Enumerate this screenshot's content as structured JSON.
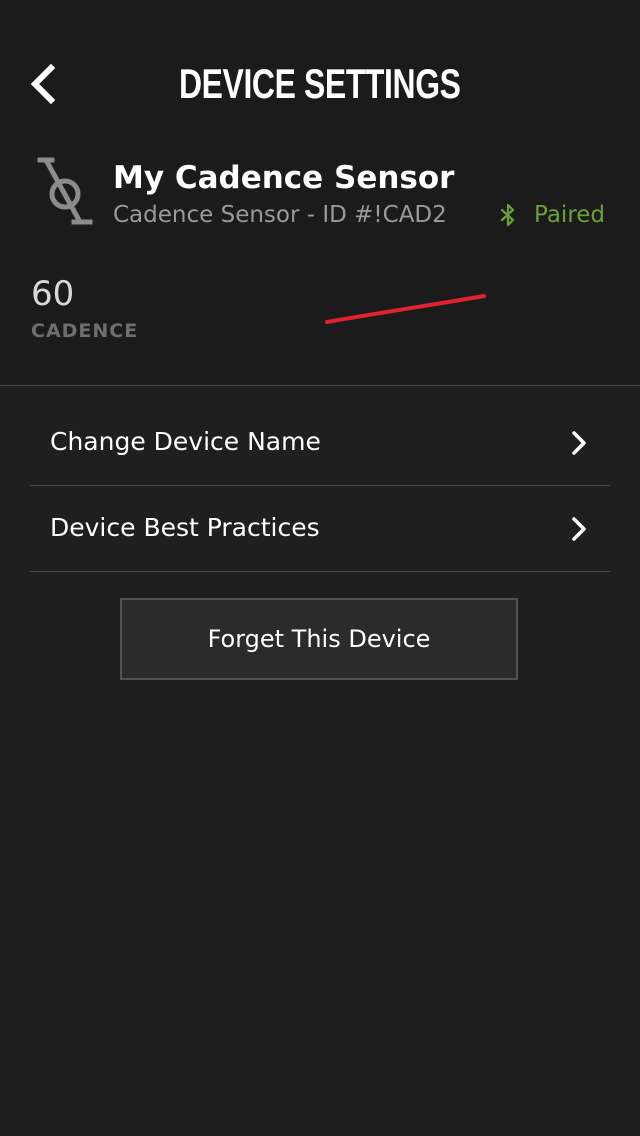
{
  "header": {
    "title": "DEVICE SETTINGS",
    "back_icon": "chevron-left-icon"
  },
  "device": {
    "icon": "cadence-crank-icon",
    "name": "My Cadence Sensor",
    "subtitle": "Cadence Sensor - ID #!CAD2",
    "status_icon": "bluetooth-icon",
    "status": "Paired",
    "status_color": "#6aa13a"
  },
  "reading": {
    "value": "60",
    "label": "CADENCE",
    "graph_color": "#e0232e"
  },
  "menu": {
    "items": [
      {
        "label": "Change Device Name",
        "icon": "chevron-right-icon"
      },
      {
        "label": "Device Best Practices",
        "icon": "chevron-right-icon"
      }
    ]
  },
  "actions": {
    "forget_label": "Forget This Device"
  }
}
